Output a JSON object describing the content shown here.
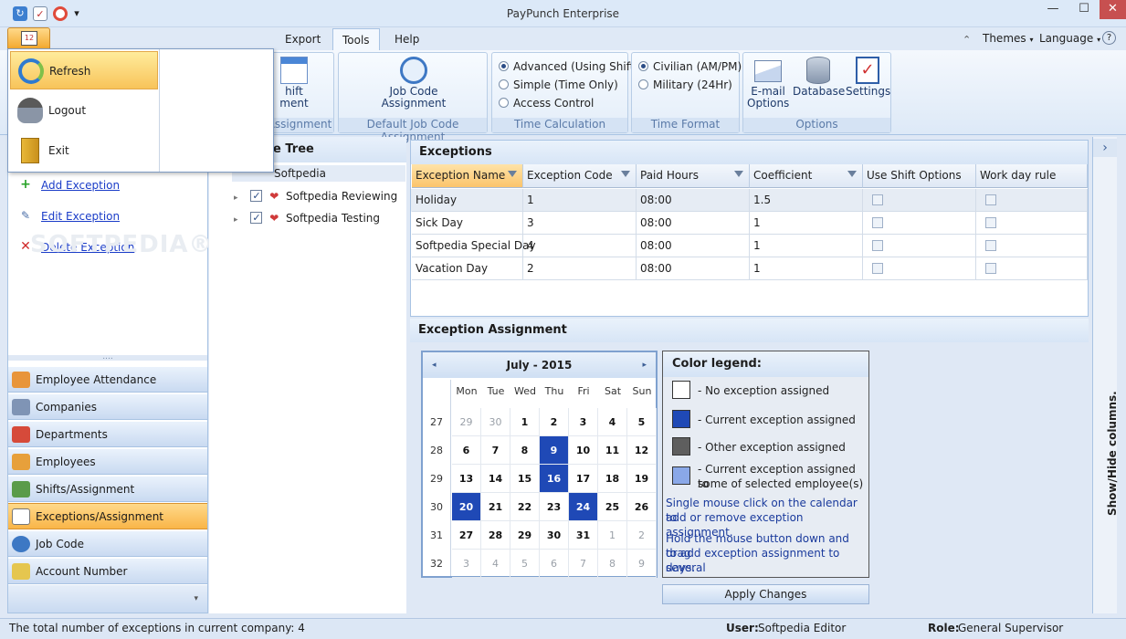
{
  "window": {
    "title": "PayPunch Enterprise",
    "minimize": "—",
    "maximize": "☐",
    "close": "✕"
  },
  "quick_access": {
    "icons": [
      "refresh-icon",
      "check-icon",
      "lifebuoy-icon"
    ],
    "dropdown": "▾"
  },
  "ribbon_tabs": [
    {
      "label": "Export"
    },
    {
      "label": "Tools"
    },
    {
      "label": "Help"
    }
  ],
  "ribbon_right": {
    "themes": "Themes",
    "language": "Language",
    "help": "?"
  },
  "ribbon": {
    "shift_group": {
      "button_line1": "hift",
      "button_line2": "ment",
      "label": "Assignment"
    },
    "job_code_group": {
      "button_line1": "Job Code",
      "button_line2": "Assignment",
      "label": "Default Job Code Assignment"
    },
    "time_calc": {
      "options": [
        "Advanced (Using Shift)",
        "Simple (Time Only)",
        "Access Control"
      ],
      "selected": 0,
      "label": "Time Calculation"
    },
    "time_format": {
      "options": [
        "Civilian (AM/PM)",
        "Military (24Hr)"
      ],
      "selected": 0,
      "label": "Time Format"
    },
    "options_group": {
      "email_line1": "E-mail",
      "email_line2": "Options",
      "database": "Database",
      "settings": "Settings",
      "label": "Options"
    }
  },
  "app_menu": {
    "items": [
      {
        "label": "Refresh"
      },
      {
        "label": "Logout"
      },
      {
        "label": "Exit"
      }
    ]
  },
  "actions": {
    "add": "Add Exception",
    "edit": "Edit Exception",
    "delete": "Delete Exception"
  },
  "watermark": "SOFTPEDIA®",
  "nav": {
    "grip": "....",
    "items": [
      {
        "label": "Employee Attendance"
      },
      {
        "label": "Companies"
      },
      {
        "label": "Departments"
      },
      {
        "label": "Employees"
      },
      {
        "label": "Shifts/Assignment"
      },
      {
        "label": "Exceptions/Assignment"
      },
      {
        "label": "Job Code"
      },
      {
        "label": "Account Number"
      }
    ],
    "chevron": "▾"
  },
  "tree": {
    "header": "e Tree",
    "root": "Softpedia",
    "children": [
      {
        "label": "Softpedia Reviewing"
      },
      {
        "label": "Softpedia Testing"
      }
    ],
    "expander": "▸"
  },
  "exceptions": {
    "title": "Exceptions",
    "columns": [
      "Exception Name",
      "Exception Code",
      "Paid Hours",
      "Coefficient",
      "Use Shift Options",
      "Work day rule"
    ],
    "rows": [
      {
        "name": "Holiday",
        "code": "1",
        "paid": "08:00",
        "coef": "1.5"
      },
      {
        "name": "Sick Day",
        "code": "3",
        "paid": "08:00",
        "coef": "1"
      },
      {
        "name": "Softpedia Special Day",
        "code": "4",
        "paid": "08:00",
        "coef": "1"
      },
      {
        "name": "Vacation Day",
        "code": "2",
        "paid": "08:00",
        "coef": "1"
      }
    ]
  },
  "assignment": {
    "title": "Exception Assignment"
  },
  "calendar": {
    "month_label": "July - 2015",
    "prev": "◂",
    "next": "▸",
    "weekdays": [
      "Mon",
      "Tue",
      "Wed",
      "Thu",
      "Fri",
      "Sat",
      "Sun"
    ],
    "weeks": [
      {
        "num": "27",
        "days": [
          [
            "29",
            "o"
          ],
          [
            "30",
            "o"
          ],
          [
            "1",
            ""
          ],
          [
            "2",
            ""
          ],
          [
            "3",
            ""
          ],
          [
            "4",
            ""
          ],
          [
            "5",
            ""
          ]
        ]
      },
      {
        "num": "28",
        "days": [
          [
            "6",
            ""
          ],
          [
            "7",
            ""
          ],
          [
            "8",
            ""
          ],
          [
            "9",
            "c"
          ],
          [
            "10",
            ""
          ],
          [
            "11",
            ""
          ],
          [
            "12",
            ""
          ]
        ]
      },
      {
        "num": "29",
        "days": [
          [
            "13",
            ""
          ],
          [
            "14",
            ""
          ],
          [
            "15",
            ""
          ],
          [
            "16",
            "c"
          ],
          [
            "17",
            ""
          ],
          [
            "18",
            ""
          ],
          [
            "19",
            ""
          ]
        ]
      },
      {
        "num": "30",
        "days": [
          [
            "20",
            "c"
          ],
          [
            "21",
            ""
          ],
          [
            "22",
            ""
          ],
          [
            "23",
            ""
          ],
          [
            "24",
            "c"
          ],
          [
            "25",
            ""
          ],
          [
            "26",
            ""
          ]
        ]
      },
      {
        "num": "31",
        "days": [
          [
            "27",
            ""
          ],
          [
            "28",
            ""
          ],
          [
            "29",
            ""
          ],
          [
            "30",
            ""
          ],
          [
            "31",
            ""
          ],
          [
            "1",
            "o"
          ],
          [
            "2",
            "o"
          ]
        ]
      },
      {
        "num": "32",
        "days": [
          [
            "3",
            "o"
          ],
          [
            "4",
            "o"
          ],
          [
            "5",
            "o"
          ],
          [
            "6",
            "o"
          ],
          [
            "7",
            "o"
          ],
          [
            "8",
            "o"
          ],
          [
            "9",
            "o"
          ]
        ]
      }
    ]
  },
  "legend": {
    "title": "Color legend:",
    "items": [
      {
        "color": "#ffffff",
        "text": "- No exception assigned"
      },
      {
        "color": "#1f49b6",
        "text": "- Current exception assigned"
      },
      {
        "color": "#5e5e5e",
        "text": "- Other exception assigned"
      },
      {
        "color": "#8aa8e8",
        "text1": "- Current exception assigned to",
        "text2": "some of selected employee(s)"
      }
    ],
    "hint1_l1": "Single mouse click on the calendar to",
    "hint1_l2": "add or remove exception assignment.",
    "hint2_l1": "Hold the mouse button down and drag",
    "hint2_l2": "to add exception assignment to several",
    "hint2_l3": "days."
  },
  "apply_button": "Apply Changes",
  "side_panel": {
    "label": "Show/Hide columns.",
    "arrow": "›"
  },
  "status": {
    "count_text": "The total number of exceptions in current company: 4",
    "user_label": "User:",
    "user": "Softpedia Editor",
    "role_label": "Role:",
    "role": "General Supervisor"
  }
}
